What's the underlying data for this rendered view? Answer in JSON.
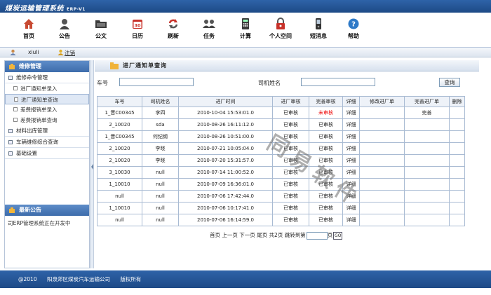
{
  "header": {
    "title": "煤炭运输管理系统",
    "version": "ERP-V1"
  },
  "toolbar": [
    {
      "label": "首页",
      "icon": "home-icon"
    },
    {
      "label": "公告",
      "icon": "announcement-icon"
    },
    {
      "label": "公文",
      "icon": "folder-icon"
    },
    {
      "label": "日历",
      "icon": "calendar-icon"
    },
    {
      "label": "刷新",
      "icon": "refresh-icon"
    },
    {
      "label": "任务",
      "icon": "task-icon"
    },
    {
      "label": "计算",
      "icon": "calculator-icon"
    },
    {
      "label": "个人空间",
      "icon": "lock-icon"
    },
    {
      "label": "短消息",
      "icon": "phone-icon"
    },
    {
      "label": "帮助",
      "icon": "help-icon"
    }
  ],
  "calendar_day": "30",
  "userbar": {
    "username": "xiuli",
    "logout": "注销"
  },
  "sidebar": {
    "title": "维修管理",
    "group1": "维修命令管理",
    "items": [
      "进厂通知单录入",
      "进厂通知单查询",
      "差费报销单录入",
      "差费报销单查询"
    ],
    "group2": "材料出库管理",
    "group3": "车辆维修综合查询",
    "group4": "基础设置"
  },
  "notice": {
    "title": "最新公告",
    "text": "司ERP管理系统正在开发中"
  },
  "panel": {
    "title": "进厂通知单查询"
  },
  "search": {
    "plate_label": "车号",
    "driver_label": "司机姓名",
    "button": "查询"
  },
  "table": {
    "headers": [
      "车号",
      "司机姓名",
      "进厂时间",
      "进厂审核",
      "完善审核",
      "详细",
      "修改进厂单",
      "完善进厂单",
      "删除"
    ],
    "rows": [
      [
        "1_晋C00345",
        "李四",
        "2010-10-04 15:53:01.0",
        "已审核",
        "未审核",
        "详细",
        "",
        "完善",
        ""
      ],
      [
        "2_10020",
        "sda",
        "2010-08-26 16:11:12.0",
        "已审核",
        "已审核",
        "详细",
        "",
        "",
        ""
      ],
      [
        "1_晋C00345",
        "何纪纲",
        "2010-08-26 10:51:00.0",
        "已审核",
        "已审核",
        "详细",
        "",
        "",
        ""
      ],
      [
        "2_10020",
        "李晓",
        "2010-07-21 10:05:04.0",
        "已审核",
        "已审核",
        "详细",
        "",
        "",
        ""
      ],
      [
        "2_10020",
        "李晓",
        "2010-07-20 15:31:57.0",
        "已审核",
        "已审核",
        "详细",
        "",
        "",
        ""
      ],
      [
        "3_10030",
        "null",
        "2010-07-14 11:00:52.0",
        "已审核",
        "已审核",
        "详细",
        "",
        "",
        ""
      ],
      [
        "1_10010",
        "null",
        "2010-07-09 16:36:01.0",
        "已审核",
        "已审核",
        "详细",
        "",
        "",
        ""
      ],
      [
        "null",
        "null",
        "2010-07-06 17:42:44.0",
        "已审核",
        "已审核",
        "详细",
        "",
        "",
        ""
      ],
      [
        "1_10010",
        "null",
        "2010-07-06 10:17:41.0",
        "已审核",
        "已审核",
        "详细",
        "",
        "",
        ""
      ],
      [
        "null",
        "null",
        "2010-07-06 16:14:59.0",
        "已审核",
        "已审核",
        "详细",
        "",
        "",
        ""
      ]
    ]
  },
  "pager": {
    "first": "首页",
    "prev": "上一页",
    "next": "下一页",
    "last": "尾页",
    "total": "共2页",
    "jump": "跳转到第",
    "page_unit": "页",
    "go": "GO"
  },
  "watermark": [
    "同",
    "易",
    "软",
    "件"
  ],
  "footer": {
    "copyright": "@2010",
    "company": "阳泉郊区煤炭汽车运输公司",
    "rights": "版权所有"
  },
  "colors": {
    "header_bg": "#2e63a8",
    "status_unreviewed": "#e00000"
  }
}
